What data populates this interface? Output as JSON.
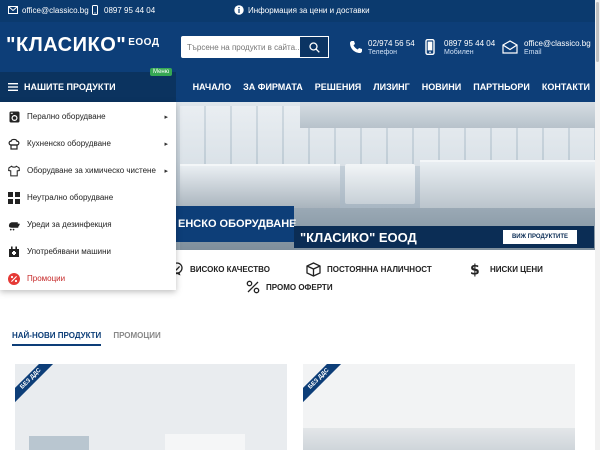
{
  "topbar": {
    "email": "office@classico.bg",
    "phone": "0897 95 44 04",
    "info": "Информация за цени и доставки"
  },
  "header": {
    "logo_text": "\"КЛАСИКО\"",
    "logo_suffix": "ЕООД",
    "search_placeholder": "Търсене на продукти в сайта...",
    "contacts": [
      {
        "value": "02/974 56 54",
        "label": "Телефон",
        "icon": "phone-icon"
      },
      {
        "value": "0897 95 44 04",
        "label": "Мобилен",
        "icon": "mobile-icon"
      },
      {
        "value": "office@classico.bg",
        "label": "Email",
        "icon": "email-icon"
      }
    ]
  },
  "nav": {
    "products_label": "НАШИТЕ ПРОДУКТИ",
    "menu_badge": "Меню",
    "links": [
      "НАЧАЛО",
      "ЗА ФИРМАТА",
      "РЕШЕНИЯ",
      "ЛИЗИНГ",
      "НОВИНИ",
      "ПАРТНЬОРИ",
      "КОНТАКТИ"
    ]
  },
  "dropdown": {
    "items": [
      {
        "label": "Перално оборудване",
        "icon": "washing-machine-icon",
        "has_submenu": true
      },
      {
        "label": "Кухненско оборудване",
        "icon": "chef-hat-icon",
        "has_submenu": true
      },
      {
        "label": "Оборудване за химическо чистене",
        "icon": "shirt-icon",
        "has_submenu": true
      },
      {
        "label": "Неутрално оборудване",
        "icon": "grid-icon",
        "has_submenu": false
      },
      {
        "label": "Уреди за дезинфекция",
        "icon": "hand-wash-icon",
        "has_submenu": false
      },
      {
        "label": "Употребявани машини",
        "icon": "tag-icon",
        "has_submenu": false
      },
      {
        "label": "Промоции",
        "icon": "percent-badge-icon",
        "has_submenu": false
      }
    ]
  },
  "hero": {
    "strip_text": "ЕНСКО ОБОРУДВАНЕ",
    "brand_text": "\"КЛАСИКО\" ЕООД",
    "button_label": "ВИЖ ПРОДУКТИТЕ"
  },
  "features": [
    {
      "label": "ВИСОКО КАЧЕСТВО",
      "icon": "quality-badge-icon"
    },
    {
      "label": "ПОСТОЯННА НАЛИЧНОСТ",
      "icon": "box-icon"
    },
    {
      "label": "НИСКИ ЦЕНИ",
      "icon": "dollar-icon"
    },
    {
      "label": "ПРОМО ОФЕРТИ",
      "icon": "percent-icon"
    }
  ],
  "tabs": [
    "НАЙ-НОВИ ПРОДУКТИ",
    "ПРОМОЦИИ"
  ],
  "cards": [
    {
      "ribbon": "БЕЗ ДДС"
    },
    {
      "ribbon": "БЕЗ ДДС"
    }
  ],
  "colors": {
    "primary": "#0d3e78",
    "topbar": "#0b3a6e",
    "accent_green": "#36a853",
    "promo_red": "#e53935"
  }
}
